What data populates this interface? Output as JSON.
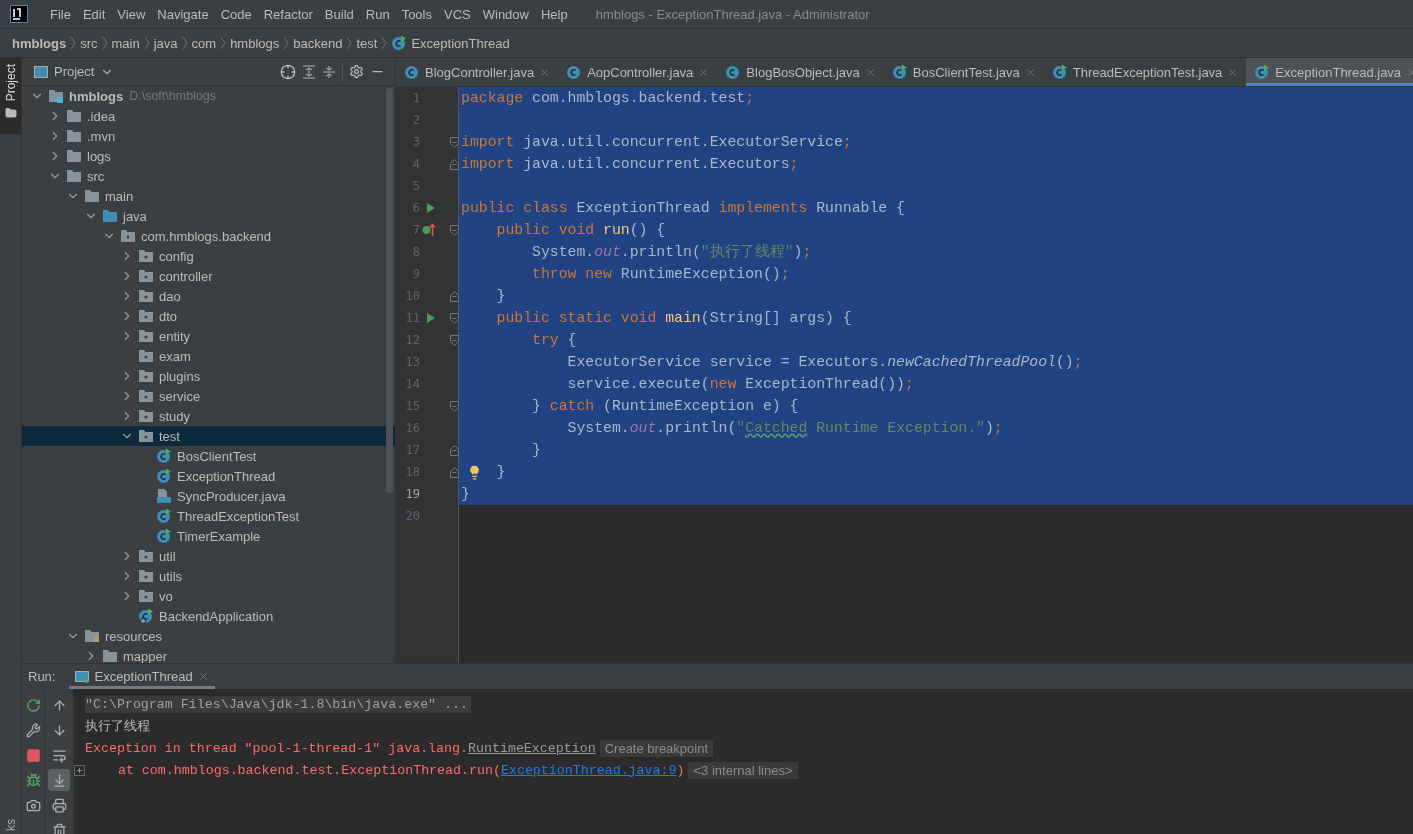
{
  "window": {
    "title": "hmblogs - ExceptionThread.java - Administrator",
    "menu": [
      "File",
      "Edit",
      "View",
      "Navigate",
      "Code",
      "Refactor",
      "Build",
      "Run",
      "Tools",
      "VCS",
      "Window",
      "Help"
    ]
  },
  "breadcrumbs": [
    {
      "label": "hmblogs",
      "kind": "project"
    },
    {
      "label": "src",
      "kind": "dir"
    },
    {
      "label": "main",
      "kind": "dir"
    },
    {
      "label": "java",
      "kind": "dir"
    },
    {
      "label": "com",
      "kind": "dir"
    },
    {
      "label": "hmblogs",
      "kind": "dir"
    },
    {
      "label": "backend",
      "kind": "dir"
    },
    {
      "label": "test",
      "kind": "dir"
    },
    {
      "label": "ExceptionThread",
      "kind": "runnable-class"
    }
  ],
  "side_strip": {
    "top": "Project",
    "bottom": "ks"
  },
  "project": {
    "title": "Project",
    "tree": [
      {
        "label": "hmblogs",
        "hint": "D:\\soft\\hmblogs",
        "kind": "module",
        "expanded": true,
        "selected": false,
        "children": [
          {
            "label": ".idea",
            "kind": "folder",
            "expanded": false,
            "selected": false
          },
          {
            "label": ".mvn",
            "kind": "folder",
            "expanded": false,
            "selected": false
          },
          {
            "label": "logs",
            "kind": "folder",
            "expanded": false,
            "selected": false
          },
          {
            "label": "src",
            "kind": "folder",
            "expanded": true,
            "selected": false,
            "children": [
              {
                "label": "main",
                "kind": "folder",
                "expanded": true,
                "selected": false,
                "children": [
                  {
                    "label": "java",
                    "kind": "source",
                    "expanded": true,
                    "selected": false,
                    "children": [
                      {
                        "label": "com.hmblogs.backend",
                        "kind": "package",
                        "expanded": true,
                        "selected": false,
                        "children": [
                          {
                            "label": "config",
                            "kind": "package",
                            "expanded": false,
                            "selected": false
                          },
                          {
                            "label": "controller",
                            "kind": "package",
                            "expanded": false,
                            "selected": false
                          },
                          {
                            "label": "dao",
                            "kind": "package",
                            "expanded": false,
                            "selected": false
                          },
                          {
                            "label": "dto",
                            "kind": "package",
                            "expanded": false,
                            "selected": false
                          },
                          {
                            "label": "entity",
                            "kind": "package",
                            "expanded": false,
                            "selected": false
                          },
                          {
                            "label": "exam",
                            "kind": "package",
                            "selected": false
                          },
                          {
                            "label": "plugins",
                            "kind": "package",
                            "expanded": false,
                            "selected": false
                          },
                          {
                            "label": "service",
                            "kind": "package",
                            "expanded": false,
                            "selected": false
                          },
                          {
                            "label": "study",
                            "kind": "package",
                            "expanded": false,
                            "selected": false
                          },
                          {
                            "label": "test",
                            "kind": "package",
                            "expanded": true,
                            "selected": true,
                            "children": [
                              {
                                "label": "BosClientTest",
                                "kind": "runnable-class",
                                "selected": false
                              },
                              {
                                "label": "ExceptionThread",
                                "kind": "runnable-class",
                                "selected": false
                              },
                              {
                                "label": "SyncProducer.java",
                                "kind": "java-file",
                                "selected": false
                              },
                              {
                                "label": "ThreadExceptionTest",
                                "kind": "runnable-class",
                                "selected": false
                              },
                              {
                                "label": "TimerExample",
                                "kind": "runnable-class",
                                "selected": false
                              }
                            ]
                          },
                          {
                            "label": "util",
                            "kind": "package",
                            "expanded": false,
                            "selected": false
                          },
                          {
                            "label": "utils",
                            "kind": "package",
                            "expanded": false,
                            "selected": false
                          },
                          {
                            "label": "vo",
                            "kind": "package",
                            "expanded": false,
                            "selected": false
                          },
                          {
                            "label": "BackendApplication",
                            "kind": "app-class",
                            "selected": false
                          }
                        ]
                      }
                    ]
                  }
                ]
              },
              {
                "label": "resources",
                "kind": "resources",
                "expanded": true,
                "selected": false,
                "children": [
                  {
                    "label": "mapper",
                    "kind": "folder",
                    "expanded": false,
                    "selected": false
                  }
                ]
              }
            ]
          }
        ]
      }
    ]
  },
  "tabs": [
    {
      "label": "BlogController.java",
      "kind": "class",
      "selected": false
    },
    {
      "label": "AopController.java",
      "kind": "class",
      "selected": false
    },
    {
      "label": "BlogBosObject.java",
      "kind": "class",
      "selected": false
    },
    {
      "label": "BosClientTest.java",
      "kind": "runnable-class",
      "selected": false
    },
    {
      "label": "ThreadExceptionTest.java",
      "kind": "runnable-class",
      "selected": false
    },
    {
      "label": "ExceptionThread.java",
      "kind": "runnable-class",
      "selected": true
    }
  ],
  "editor": {
    "lines": [
      {
        "number": "1",
        "selected": true,
        "current": false,
        "fold_start": false,
        "fold_end": false,
        "tokens": [
          {
            "kind": "kw",
            "text": "package "
          },
          {
            "kind": "text",
            "text": "com.hmblogs.backend.test"
          },
          {
            "kind": "kw",
            "text": ";"
          }
        ]
      },
      {
        "number": "2",
        "selected": true,
        "current": false,
        "fold_start": false,
        "fold_end": false
      },
      {
        "number": "3",
        "selected": true,
        "current": false,
        "fold_start": true,
        "fold_end": false,
        "tokens": [
          {
            "kind": "kw",
            "text": "import "
          },
          {
            "kind": "text",
            "text": "java.util.concurrent.ExecutorService"
          },
          {
            "kind": "kw",
            "text": ";"
          }
        ]
      },
      {
        "number": "4",
        "selected": true,
        "current": false,
        "fold_start": false,
        "fold_end": true,
        "tokens": [
          {
            "kind": "kw",
            "text": "import "
          },
          {
            "kind": "text",
            "text": "java.util.concurrent.Executors"
          },
          {
            "kind": "kw",
            "text": ";"
          }
        ]
      },
      {
        "number": "5",
        "selected": true,
        "current": false,
        "fold_start": false,
        "fold_end": false
      },
      {
        "number": "6",
        "selected": true,
        "current": false,
        "fold_start": false,
        "fold_end": false,
        "gutter_icon": {
          "kind": "run"
        },
        "tokens": [
          {
            "kind": "kw",
            "text": "public class "
          },
          {
            "kind": "text",
            "text": "ExceptionThread "
          },
          {
            "kind": "kw",
            "text": "implements "
          },
          {
            "kind": "text",
            "text": "Runnable {"
          }
        ]
      },
      {
        "number": "7",
        "selected": true,
        "current": false,
        "fold_start": true,
        "fold_end": false,
        "gutter_icon": {
          "kind": "implements"
        },
        "tokens": [
          {
            "kind": "kw",
            "text": "    public void "
          },
          {
            "kind": "fn",
            "text": "run"
          },
          {
            "kind": "text",
            "text": "() {"
          }
        ]
      },
      {
        "number": "8",
        "selected": true,
        "current": false,
        "fold_start": false,
        "fold_end": false,
        "tokens": [
          {
            "kind": "text",
            "text": "        System."
          },
          {
            "kind": "static",
            "text": "out"
          },
          {
            "kind": "text",
            "text": ".println("
          },
          {
            "kind": "str",
            "text": "\"执行了线程\""
          },
          {
            "kind": "text",
            "text": ")"
          },
          {
            "kind": "kw",
            "text": ";"
          }
        ]
      },
      {
        "number": "9",
        "selected": true,
        "current": false,
        "fold_start": false,
        "fold_end": false,
        "tokens": [
          {
            "kind": "kw",
            "text": "        throw new "
          },
          {
            "kind": "text",
            "text": "RuntimeException()"
          },
          {
            "kind": "kw",
            "text": ";"
          }
        ]
      },
      {
        "number": "10",
        "selected": true,
        "current": false,
        "fold_start": false,
        "fold_end": true,
        "tokens": [
          {
            "kind": "text",
            "text": "    }"
          }
        ]
      },
      {
        "number": "11",
        "selected": true,
        "current": false,
        "fold_start": true,
        "fold_end": false,
        "gutter_icon": {
          "kind": "run"
        },
        "tokens": [
          {
            "kind": "kw",
            "text": "    public static void "
          },
          {
            "kind": "fn",
            "text": "main"
          },
          {
            "kind": "text",
            "text": "(String[] args) {"
          }
        ]
      },
      {
        "number": "12",
        "selected": true,
        "current": false,
        "fold_start": true,
        "fold_end": false,
        "tokens": [
          {
            "kind": "kw",
            "text": "        try "
          },
          {
            "kind": "text",
            "text": "{"
          }
        ]
      },
      {
        "number": "13",
        "selected": true,
        "current": false,
        "fold_start": false,
        "fold_end": false,
        "tokens": [
          {
            "kind": "text",
            "text": "            ExecutorService service = Executors."
          },
          {
            "kind": "italic",
            "text": "newCachedThreadPool"
          },
          {
            "kind": "text",
            "text": "()"
          },
          {
            "kind": "kw",
            "text": ";"
          }
        ]
      },
      {
        "number": "14",
        "selected": true,
        "current": false,
        "fold_start": false,
        "fold_end": false,
        "tokens": [
          {
            "kind": "text",
            "text": "            service.execute("
          },
          {
            "kind": "kw",
            "text": "new "
          },
          {
            "kind": "text",
            "text": "ExceptionThread())"
          },
          {
            "kind": "kw",
            "text": ";"
          }
        ]
      },
      {
        "number": "15",
        "selected": true,
        "current": false,
        "fold_start": true,
        "fold_end": false,
        "tokens": [
          {
            "kind": "text",
            "text": "        } "
          },
          {
            "kind": "kw",
            "text": "catch "
          },
          {
            "kind": "text",
            "text": "(RuntimeException e) {"
          }
        ]
      },
      {
        "number": "16",
        "selected": true,
        "current": false,
        "fold_start": false,
        "fold_end": false,
        "tokens": [
          {
            "kind": "text",
            "text": "            System."
          },
          {
            "kind": "static",
            "text": "out"
          },
          {
            "kind": "text",
            "text": ".println("
          },
          {
            "kind": "str",
            "text": "\""
          },
          {
            "kind": "typo",
            "text": "Catched"
          },
          {
            "kind": "str",
            "text": " Runtime Exception.\""
          },
          {
            "kind": "text",
            "text": ")"
          },
          {
            "kind": "kw",
            "text": ";"
          }
        ]
      },
      {
        "number": "17",
        "selected": true,
        "current": false,
        "fold_start": false,
        "fold_end": true,
        "tokens": [
          {
            "kind": "text",
            "text": "        }"
          }
        ]
      },
      {
        "number": "18",
        "selected": true,
        "current": false,
        "fold_start": false,
        "fold_end": true,
        "gutter_icon": {
          "kind": "bulb"
        },
        "tokens": [
          {
            "kind": "text",
            "text": "    }"
          }
        ]
      },
      {
        "number": "19",
        "selected": true,
        "current": true,
        "fold_start": false,
        "fold_end": false,
        "tokens": [
          {
            "kind": "text",
            "text": "}"
          }
        ]
      },
      {
        "number": "20",
        "selected": false,
        "current": false,
        "fold_start": false,
        "fold_end": false
      }
    ]
  },
  "run": {
    "label": "Run:",
    "tab": {
      "label": "ExceptionThread",
      "selected": true
    },
    "console": [
      {
        "kind": "command",
        "foldable": false,
        "parts": [
          {
            "kind": "plain",
            "text": "\"C:\\Program Files\\Java\\jdk-1.8\\bin\\java.exe\" ..."
          }
        ]
      },
      {
        "kind": "out",
        "foldable": false,
        "parts": [
          {
            "kind": "plain",
            "text": "执行了线程"
          }
        ]
      },
      {
        "kind": "error",
        "foldable": false,
        "parts": [
          {
            "kind": "plain",
            "text": "Exception in thread \"pool-1-thread-1\" java.lang."
          },
          {
            "kind": "class",
            "text": "RuntimeException"
          },
          {
            "kind": "chip",
            "text": "Create breakpoint"
          }
        ]
      },
      {
        "kind": "error",
        "foldable": true,
        "parts": [
          {
            "kind": "plain",
            "text": "    at com.hmblogs.backend.test.ExceptionThread.run("
          },
          {
            "kind": "link",
            "text": "ExceptionThread.java:9"
          },
          {
            "kind": "plain",
            "text": ")"
          },
          {
            "kind": "chip",
            "text": "<3 internal lines>"
          }
        ]
      }
    ],
    "left_tools": [
      {
        "kind": "rerun"
      },
      {
        "kind": "wrench"
      },
      {
        "kind": "stop"
      },
      {
        "kind": "debug"
      },
      {
        "kind": "camera"
      }
    ],
    "right_tools": [
      {
        "kind": "up",
        "selected": false
      },
      {
        "kind": "down",
        "selected": false
      },
      {
        "kind": "wrap",
        "selected": false
      },
      {
        "kind": "scroll-end",
        "selected": true
      },
      {
        "kind": "print",
        "selected": false
      },
      {
        "kind": "trash",
        "selected": false
      }
    ]
  }
}
